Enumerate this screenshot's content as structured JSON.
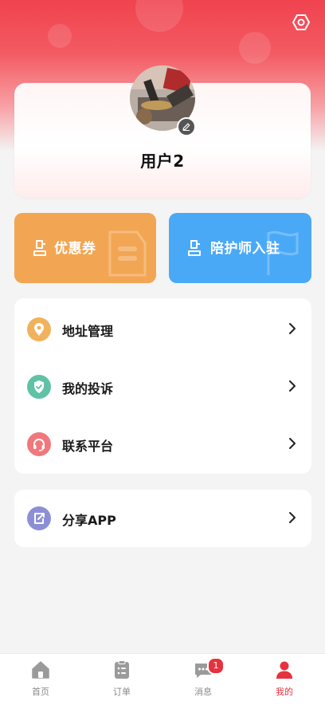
{
  "profile": {
    "username": "用户2"
  },
  "actions": {
    "coupon_label": "优惠券",
    "escort_label": "陪护师入驻"
  },
  "menu": {
    "items": [
      {
        "label": "地址管理",
        "icon": "location-pin-icon",
        "color": "#f0b25c"
      },
      {
        "label": "我的投诉",
        "icon": "shield-check-icon",
        "color": "#5fc2a6"
      },
      {
        "label": "联系平台",
        "icon": "headset-icon",
        "color": "#f0787c"
      }
    ],
    "share": {
      "label": "分享APP",
      "icon": "share-icon",
      "color": "#8d8fd6"
    }
  },
  "tabbar": {
    "tabs": [
      {
        "label": "首页",
        "icon": "home-icon"
      },
      {
        "label": "订单",
        "icon": "order-icon"
      },
      {
        "label": "消息",
        "icon": "message-icon",
        "badge": "1"
      },
      {
        "label": "我的",
        "icon": "user-icon",
        "active": true
      }
    ]
  },
  "colors": {
    "brand_red": "#e6323e",
    "coupon_orange": "#f2a653",
    "escort_blue": "#4aa9f7"
  }
}
